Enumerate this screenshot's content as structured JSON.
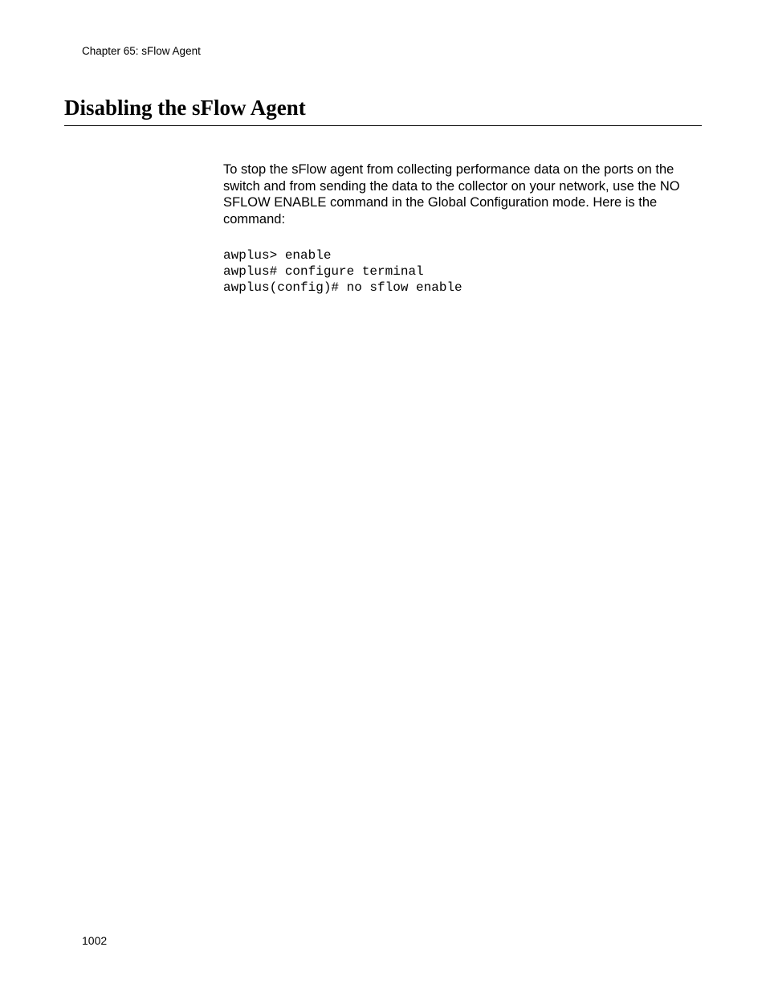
{
  "header": "Chapter 65: sFlow Agent",
  "title": "Disabling the sFlow Agent",
  "body": "To stop the sFlow agent from collecting performance data on the ports on the switch and from sending the data to the collector on your network, use the NO SFLOW ENABLE command in the Global Configuration mode. Here is the command:",
  "code": "awplus> enable\nawplus# configure terminal\nawplus(config)# no sflow enable",
  "page_number": "1002"
}
